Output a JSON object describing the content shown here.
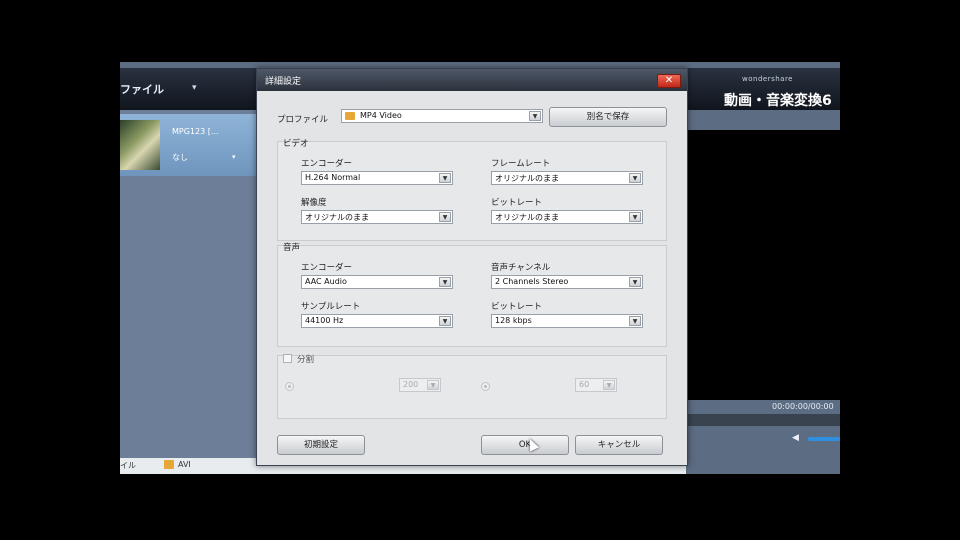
{
  "app": {
    "menu_file": "ファイル",
    "menu_arrow": "▾",
    "brand_logo": "wondershare",
    "brand_title": "動画・音楽変換6",
    "file_name": "MPG123 [...",
    "file_sub": "なし",
    "timecode": "00:00:00/00:00",
    "bottom_label": "イル",
    "bottom_format": "AVI"
  },
  "dialog": {
    "title": "詳細設定",
    "close_glyph": "✕",
    "profile_label": "プロファイル",
    "profile_value": "MP4 Video",
    "save_as_label": "別名で保存",
    "video": {
      "heading": "ビデオ",
      "encoder_label": "エンコーダー",
      "encoder_value": "H.264 Normal",
      "framerate_label": "フレームレート",
      "framerate_value": "オリジナルのまま",
      "resolution_label": "解像度",
      "resolution_value": "オリジナルのまま",
      "bitrate_label": "ビットレート",
      "bitrate_value": "オリジナルのまま"
    },
    "audio": {
      "heading": "音声",
      "encoder_label": "エンコーダー",
      "encoder_value": "AAC Audio",
      "channel_label": "音声チャンネル",
      "channel_value": "2 Channels Stereo",
      "samplerate_label": "サンプルレート",
      "samplerate_value": "44100 Hz",
      "bitrate_label": "ビットレート",
      "bitrate_value": "128 kbps"
    },
    "split": {
      "label": "分割",
      "option1_value": "200",
      "option2_value": "60"
    },
    "reset_label": "初期設定",
    "ok_label": "OK",
    "cancel_label": "キャンセル"
  },
  "colors": {
    "titlebar": "#2c323c",
    "close_button": "#c1271a",
    "volume_accent": "#2f8fe0",
    "profile_icon": "#e7a737"
  },
  "icons": {
    "close": "close-icon",
    "dropdown": "chevron-down-icon",
    "volume": "speaker-icon",
    "format": "video-format-icon"
  }
}
